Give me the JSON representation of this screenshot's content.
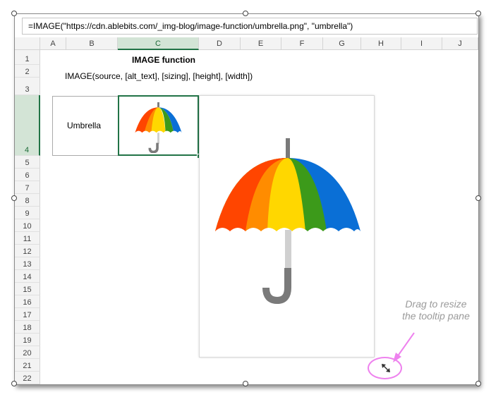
{
  "formula_bar": {
    "value": "=IMAGE(\"https://cdn.ablebits.com/_img-blog/image-function/umbrella.png\", \"umbrella\")"
  },
  "columns": [
    "A",
    "B",
    "C",
    "D",
    "E",
    "F",
    "G",
    "H",
    "I",
    "J"
  ],
  "rows": [
    "1",
    "2",
    "3",
    "4",
    "5",
    "6",
    "7",
    "8",
    "9",
    "10",
    "11",
    "12",
    "13",
    "14",
    "15",
    "16",
    "17",
    "18",
    "19",
    "20",
    "21",
    "22"
  ],
  "selected_cell": {
    "column": "C",
    "row": "4"
  },
  "cells": {
    "title": "IMAGE function",
    "syntax": "IMAGE(source, [alt_text], [sizing], [height], [width])",
    "b4": "Umbrella"
  },
  "annotation": {
    "line1": "Drag to resize",
    "line2": "the tooltip pane"
  },
  "icons": {
    "resize": "resize-diagonal-icon",
    "umbrella": "umbrella-image"
  },
  "colors": {
    "accent": "#217346",
    "umbrella_stripes": [
      "#ff4500",
      "#ff8c00",
      "#ffd700",
      "#3c9a1a",
      "#0a6fd6"
    ],
    "annotation_ring": "#ee82ee",
    "annotation_text": "#9a9a9a"
  }
}
